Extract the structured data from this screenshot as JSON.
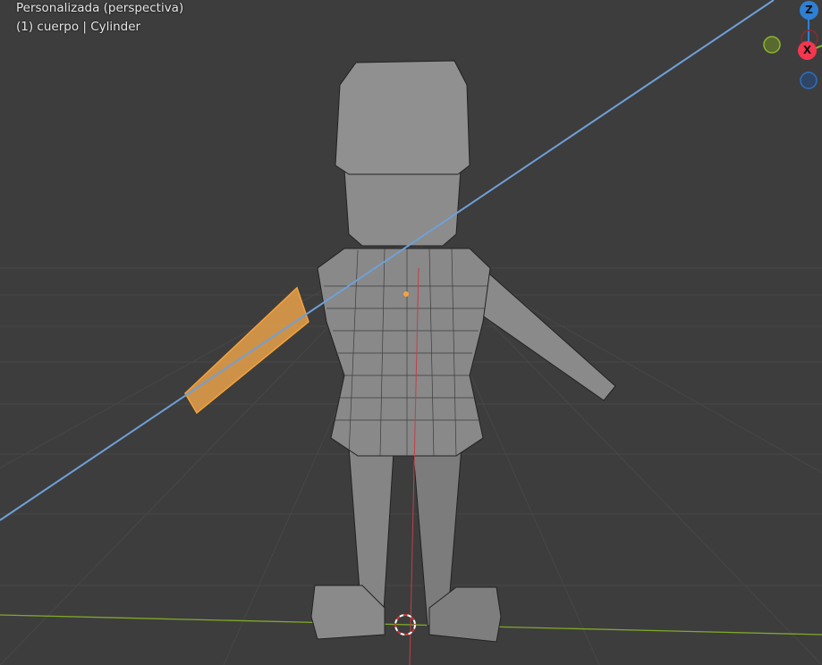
{
  "viewport": {
    "view_name": "Personalizada (perspectiva)",
    "object_info": "(1) cuerpo | Cylinder"
  },
  "gizmo": {
    "z_label": "Z",
    "x_label": "X",
    "colors": {
      "x": "#f5364f",
      "y": "#8bb532",
      "z": "#2e80d6"
    }
  },
  "colors": {
    "background": "#3d3d3d",
    "selection": "#f5a23a",
    "x_axis_line": "#c0404a",
    "y_axis_line": "#7fa82a",
    "guide_line": "#6fa0d8"
  }
}
